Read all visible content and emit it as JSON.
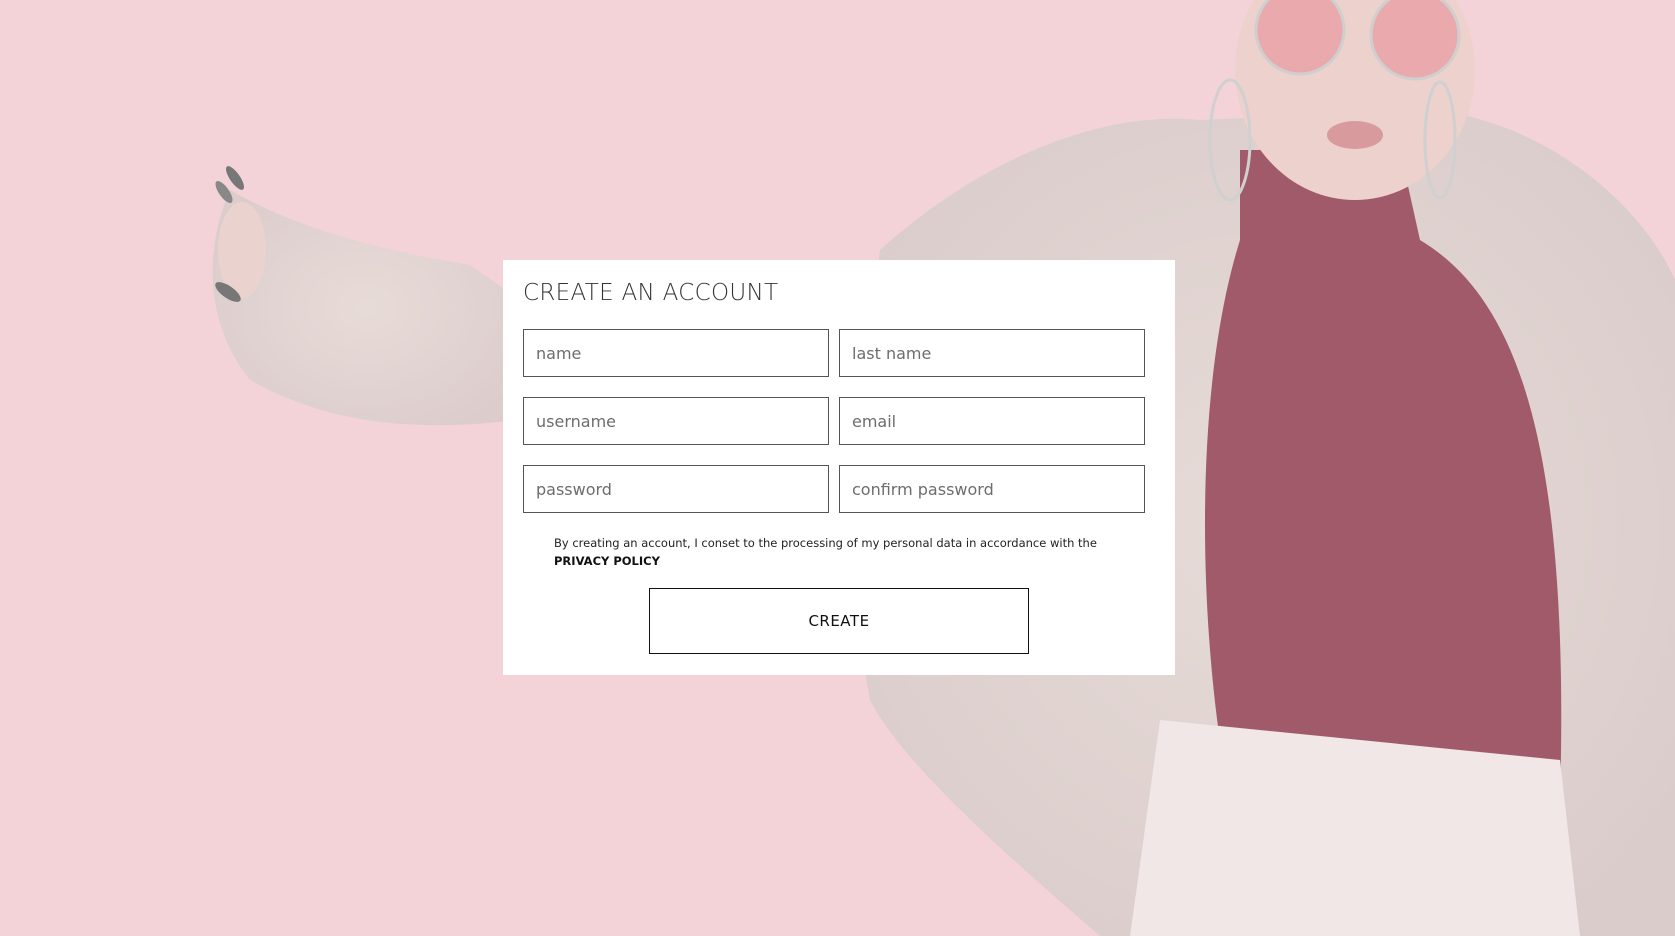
{
  "form": {
    "title": "CREATE AN ACCOUNT",
    "fields": {
      "name": {
        "placeholder": "name",
        "value": ""
      },
      "last_name": {
        "placeholder": "last name",
        "value": ""
      },
      "username": {
        "placeholder": "username",
        "value": ""
      },
      "email": {
        "placeholder": "email",
        "value": ""
      },
      "password": {
        "placeholder": "password",
        "value": ""
      },
      "confirm_password": {
        "placeholder": "confirm password",
        "value": ""
      }
    },
    "consent_text": "By creating an account, I conset to the processing of my personal data in accordance with the ",
    "privacy_link": "PRIVACY POLICY",
    "submit_label": "CREATE"
  },
  "colors": {
    "background": "#f3d3d8",
    "card": "#ffffff",
    "border": "#555555",
    "text": "#333333"
  }
}
